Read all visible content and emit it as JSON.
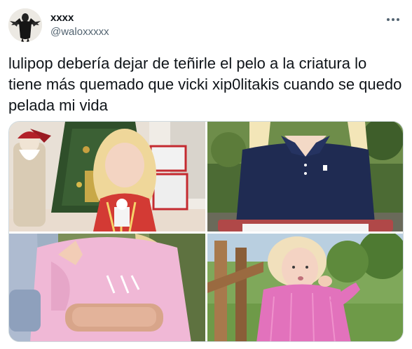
{
  "author": {
    "display_name": "xxxx",
    "handle": "@waloxxxxx"
  },
  "tweet": {
    "text": "lulipop debería dejar de teñirle el pelo a la criatura lo tiene más quemado que vicki xip0litakis cuando se quedo pelada mi vida"
  },
  "icons": {
    "more": "more-options-icon"
  },
  "media": [
    {
      "description_name": "photo-girl-christmas"
    },
    {
      "description_name": "photo-girl-navy-polo"
    },
    {
      "description_name": "photo-girl-pink-hoodie-held"
    },
    {
      "description_name": "photo-girl-pink-dress-garden"
    }
  ],
  "colors": {
    "text": "#0f1419",
    "secondary_text": "#536471",
    "border": "#cfd9de"
  }
}
